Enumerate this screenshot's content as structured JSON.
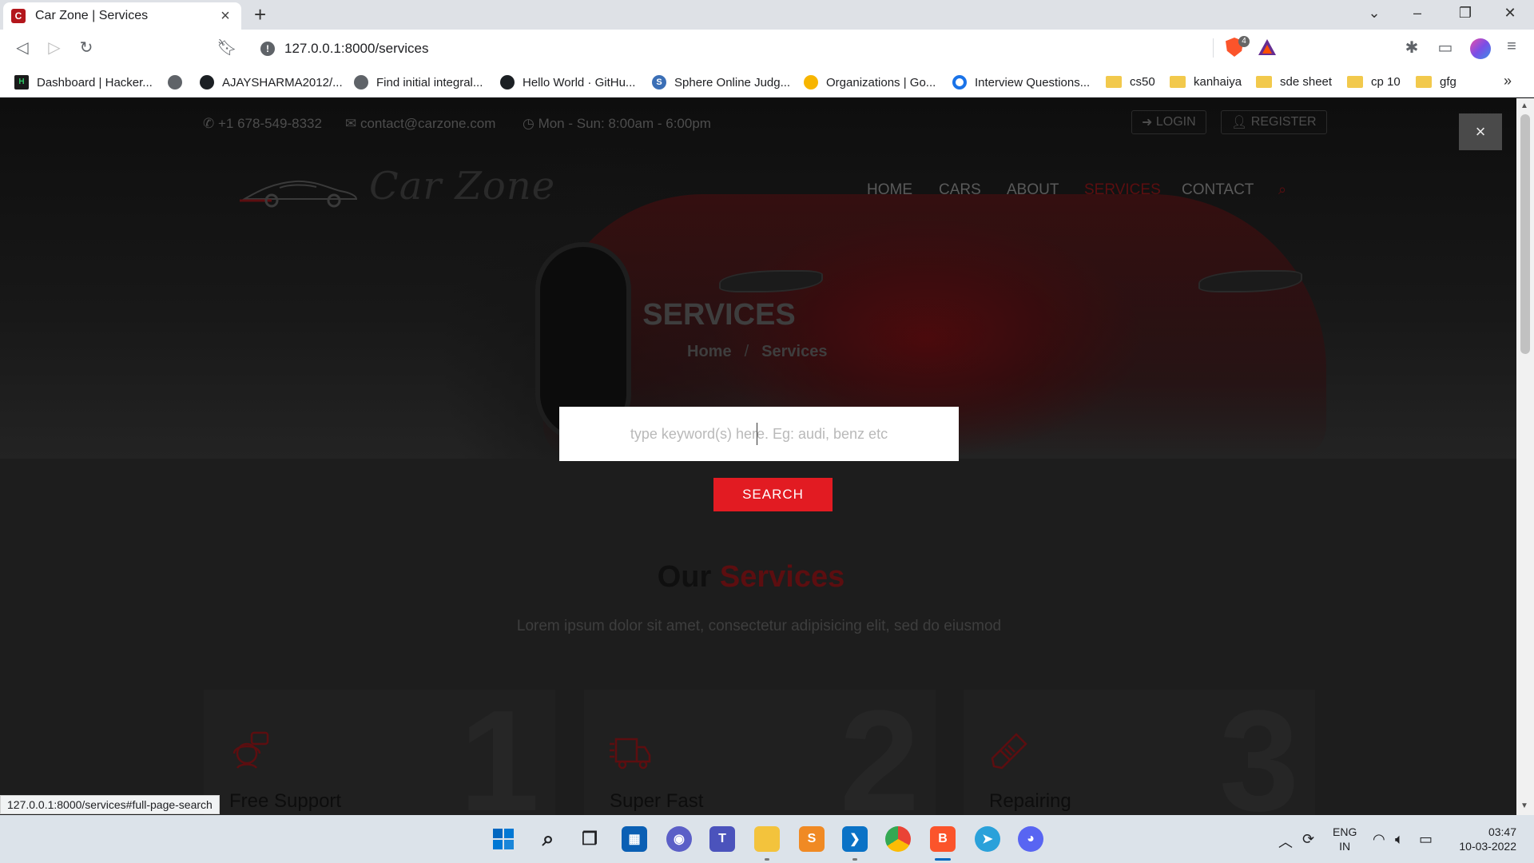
{
  "browser": {
    "tab_title": "Car Zone | Services",
    "favicon_letter": "C",
    "url": "127.0.0.1:8000/services",
    "shield_count": "4",
    "status_url": "127.0.0.1:8000/services#full-page-search",
    "bookmarks": [
      {
        "label": "Dashboard | Hacker...",
        "icon": "hackerrank-icon"
      },
      {
        "label": "",
        "icon": "globe-icon"
      },
      {
        "label": "AJAYSHARMA2012/...",
        "icon": "github-icon"
      },
      {
        "label": "Find initial integral...",
        "icon": "globe-icon"
      },
      {
        "label": "Hello World · GitHu...",
        "icon": "github-icon"
      },
      {
        "label": "Sphere Online Judg...",
        "icon": "spoj-icon"
      },
      {
        "label": "Organizations | Go...",
        "icon": "sun-icon"
      },
      {
        "label": "Interview Questions...",
        "icon": "g-icon"
      },
      {
        "label": "cs50",
        "icon": "folder-icon"
      },
      {
        "label": "kanhaiya",
        "icon": "folder-icon"
      },
      {
        "label": "sde sheet",
        "icon": "folder-icon"
      },
      {
        "label": "cp 10",
        "icon": "folder-icon"
      },
      {
        "label": "gfg",
        "icon": "folder-icon"
      }
    ]
  },
  "site": {
    "topbar": {
      "phone": "+1 678-549-8332",
      "email": "contact@carzone.com",
      "hours": "Mon - Sun: 8:00am - 6:00pm",
      "login": "LOGIN",
      "register": "REGISTER"
    },
    "logo_text": "Car Zone",
    "nav": [
      "HOME",
      "CARS",
      "ABOUT",
      "SERVICES",
      "CONTACT"
    ],
    "active_nav": "SERVICES",
    "hero_title": "SERVICES",
    "breadcrumb": [
      "Home",
      "/",
      "Services"
    ],
    "search_placeholder": "type keyword(s) here. Eg: audi, benz etc",
    "search_button": "SEARCH",
    "close_symbol": "×",
    "section": {
      "title_plain": "Our",
      "title_accent": "Services",
      "subtitle": "Lorem ipsum dolor sit amet, consectetur adipisicing elit, sed do eiusmod"
    },
    "cards": [
      {
        "number": "1",
        "title": "Free Support",
        "icon": "support-agent-icon"
      },
      {
        "number": "2",
        "title": "Super Fast",
        "icon": "delivery-truck-icon"
      },
      {
        "number": "3",
        "title": "Repairing",
        "icon": "spark-plug-icon"
      }
    ],
    "accent_color": "#e21b22"
  },
  "taskbar": {
    "language": "ENG",
    "region": "IN",
    "time": "03:47",
    "date": "10-03-2022"
  }
}
